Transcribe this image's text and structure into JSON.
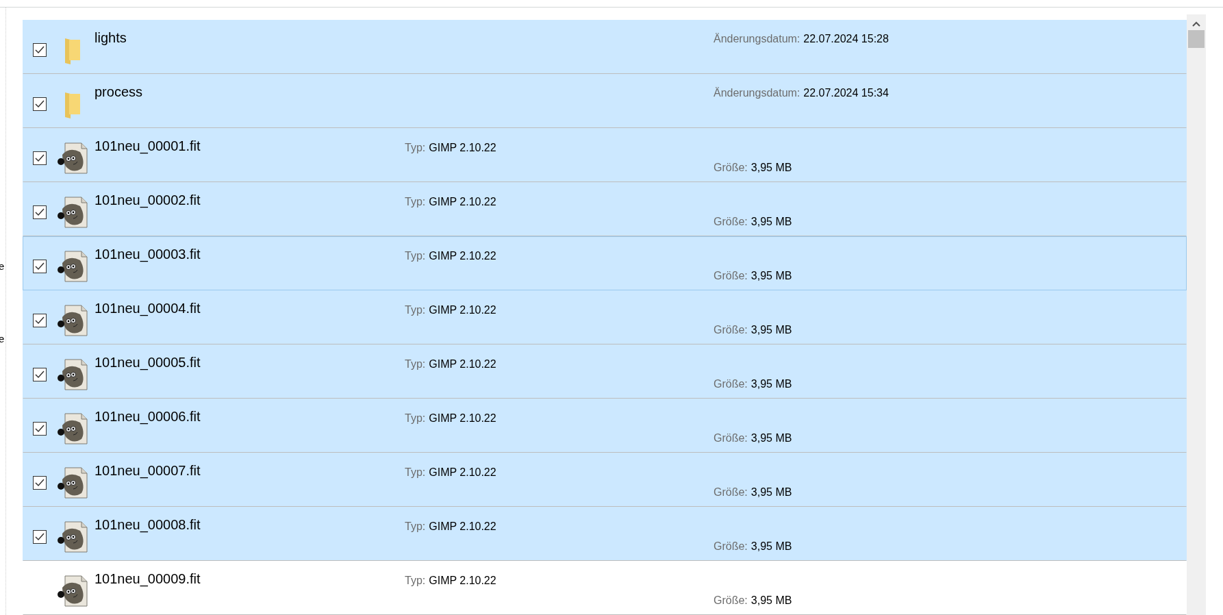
{
  "nav_fragments": [
    "e",
    "e"
  ],
  "items": [
    {
      "kind": "folder",
      "name": "lights",
      "selected": true,
      "checked": true,
      "focused": false,
      "date_label": "Änderungsdatum:",
      "date": "22.07.2024 15:28"
    },
    {
      "kind": "folder",
      "name": "process",
      "selected": true,
      "checked": true,
      "focused": false,
      "date_label": "Änderungsdatum:",
      "date": "22.07.2024 15:34"
    },
    {
      "kind": "file",
      "name": "101neu_00001.fit",
      "selected": true,
      "checked": true,
      "focused": false,
      "type_label": "Typ:",
      "type": "GIMP 2.10.22",
      "size_label": "Größe:",
      "size": "3,95 MB"
    },
    {
      "kind": "file",
      "name": "101neu_00002.fit",
      "selected": true,
      "checked": true,
      "focused": false,
      "type_label": "Typ:",
      "type": "GIMP 2.10.22",
      "size_label": "Größe:",
      "size": "3,95 MB"
    },
    {
      "kind": "file",
      "name": "101neu_00003.fit",
      "selected": true,
      "checked": true,
      "focused": true,
      "type_label": "Typ:",
      "type": "GIMP 2.10.22",
      "size_label": "Größe:",
      "size": "3,95 MB"
    },
    {
      "kind": "file",
      "name": "101neu_00004.fit",
      "selected": true,
      "checked": true,
      "focused": false,
      "type_label": "Typ:",
      "type": "GIMP 2.10.22",
      "size_label": "Größe:",
      "size": "3,95 MB"
    },
    {
      "kind": "file",
      "name": "101neu_00005.fit",
      "selected": true,
      "checked": true,
      "focused": false,
      "type_label": "Typ:",
      "type": "GIMP 2.10.22",
      "size_label": "Größe:",
      "size": "3,95 MB"
    },
    {
      "kind": "file",
      "name": "101neu_00006.fit",
      "selected": true,
      "checked": true,
      "focused": false,
      "type_label": "Typ:",
      "type": "GIMP 2.10.22",
      "size_label": "Größe:",
      "size": "3,95 MB"
    },
    {
      "kind": "file",
      "name": "101neu_00007.fit",
      "selected": true,
      "checked": true,
      "focused": false,
      "type_label": "Typ:",
      "type": "GIMP 2.10.22",
      "size_label": "Größe:",
      "size": "3,95 MB"
    },
    {
      "kind": "file",
      "name": "101neu_00008.fit",
      "selected": true,
      "checked": true,
      "focused": false,
      "type_label": "Typ:",
      "type": "GIMP 2.10.22",
      "size_label": "Größe:",
      "size": "3,95 MB"
    },
    {
      "kind": "file",
      "name": "101neu_00009.fit",
      "selected": false,
      "checked": false,
      "focused": false,
      "type_label": "Typ:",
      "type": "GIMP 2.10.22",
      "size_label": "Größe:",
      "size": "3,95 MB"
    }
  ]
}
